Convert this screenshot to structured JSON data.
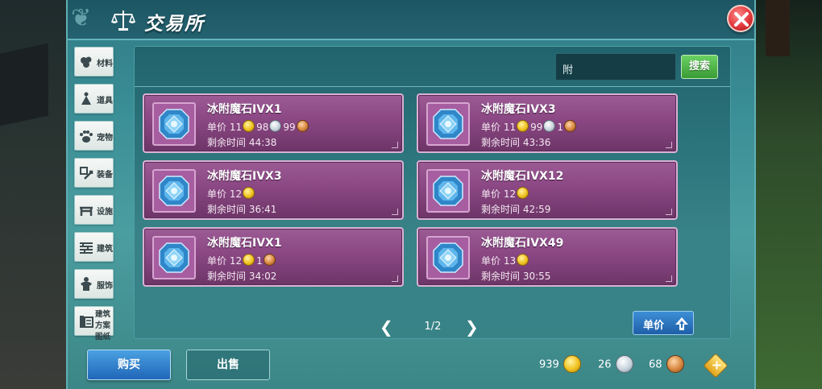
{
  "window": {
    "title": "交易所"
  },
  "search": {
    "value": "附",
    "button_label": "搜索"
  },
  "sidebar": {
    "items": [
      {
        "label": "材料",
        "icon": "materials-icon"
      },
      {
        "label": "道具",
        "icon": "props-icon"
      },
      {
        "label": "宠物",
        "icon": "pet-paw-icon"
      },
      {
        "label": "装备",
        "icon": "equipment-icon"
      },
      {
        "label": "设施",
        "icon": "facility-icon"
      },
      {
        "label": "建筑",
        "icon": "building-icon"
      },
      {
        "label": "服饰",
        "icon": "clothing-icon"
      },
      {
        "label": "建筑方案图纸",
        "icon": "blueprint-icon"
      }
    ]
  },
  "listings": {
    "price_label": "单价",
    "time_label": "剩余时间",
    "items": [
      {
        "name": "冰附魔石IVX1",
        "gold": "11",
        "silver": "98",
        "copper": "99",
        "time": "44:38"
      },
      {
        "name": "冰附魔石IVX3",
        "gold": "11",
        "silver": "99",
        "copper": "1",
        "time": "43:36"
      },
      {
        "name": "冰附魔石IVX3",
        "gold": "12",
        "silver": null,
        "copper": null,
        "time": "36:41"
      },
      {
        "name": "冰附魔石IVX12",
        "gold": "12",
        "silver": null,
        "copper": null,
        "time": "42:59"
      },
      {
        "name": "冰附魔石IVX1",
        "gold": "12",
        "silver": null,
        "copper": "1",
        "time": "34:02"
      },
      {
        "name": "冰附魔石IVX49",
        "gold": "13",
        "silver": null,
        "copper": null,
        "time": "30:55"
      }
    ]
  },
  "pagination": {
    "label": "1/2"
  },
  "sort": {
    "label": "单价"
  },
  "bottom": {
    "buy_label": "购买",
    "sell_label": "出售",
    "gold": "939",
    "silver": "26",
    "copper": "68"
  },
  "colors": {
    "panel": "#3b8f96",
    "item_card": "#8a4783",
    "search_button": "#3a9c35",
    "buy_button": "#2066b8",
    "close_button": "#e2373b"
  }
}
